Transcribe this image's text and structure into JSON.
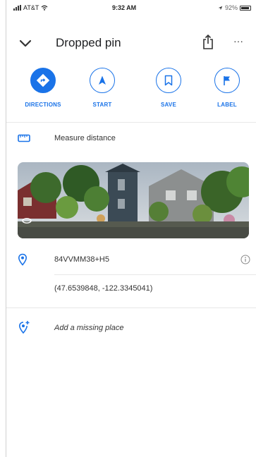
{
  "status_bar": {
    "carrier": "AT&T",
    "time": "9:32 AM",
    "battery_percent": "92%",
    "battery_level": 0.92
  },
  "header": {
    "title": "Dropped pin",
    "back_icon": "chevron-down-icon",
    "share_icon": "share-icon",
    "more_icon": "more-horizontal-icon",
    "more_label": "···"
  },
  "actions": [
    {
      "label": "DIRECTIONS",
      "icon": "directions-icon"
    },
    {
      "label": "START",
      "icon": "navigation-arrow-icon"
    },
    {
      "label": "SAVE",
      "icon": "bookmark-icon"
    },
    {
      "label": "LABEL",
      "icon": "flag-icon"
    }
  ],
  "measure": {
    "label": "Measure distance",
    "icon": "ruler-icon"
  },
  "street_view": {
    "icon": "street-view-icon"
  },
  "location": {
    "plus_code": "84VVMM38+H5",
    "coordinates": "(47.6539848, -122.3345041)",
    "pin_icon": "location-pin-icon",
    "info_icon": "info-icon"
  },
  "missing_place": {
    "label": "Add a missing place",
    "icon": "add-location-icon"
  },
  "colors": {
    "accent": "#1a73e8",
    "text": "#202124",
    "divider": "#e8e8e8"
  }
}
